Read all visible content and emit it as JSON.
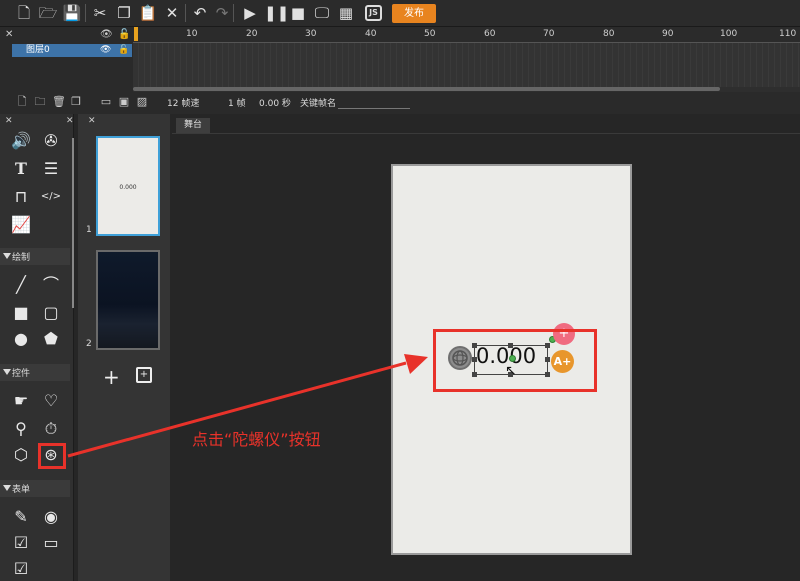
{
  "toolbar": {
    "icons": [
      "new-file-icon",
      "open-folder-icon",
      "save-icon",
      "cut-icon",
      "copy-icon",
      "paste-icon",
      "delete-icon",
      "undo-icon",
      "redo-icon",
      "play-icon",
      "pause-icon",
      "stop-icon",
      "preview-icon",
      "qrcode-icon",
      "js-icon"
    ],
    "js_label": "JS",
    "publish_label": "发布"
  },
  "timeline": {
    "ruler": [
      "10",
      "20",
      "30",
      "40",
      "50",
      "60",
      "70",
      "80",
      "90",
      "100",
      "110"
    ],
    "layer_name": "图层0",
    "fps": "12 帧速",
    "frame": "1 帧",
    "time": "0.00 秒",
    "keyframe_label": "关键帧名"
  },
  "tool_panel": {
    "sections": [
      "绘制",
      "控件",
      "表单"
    ]
  },
  "slides": [
    {
      "num": "1",
      "text": "0.000"
    },
    {
      "num": "2",
      "text": ""
    }
  ],
  "stage": {
    "tab_label": "舞台",
    "gyro_value": "0.000"
  },
  "annotation": {
    "text": "点击“陀螺仪”按钮",
    "color": "#e8322a"
  }
}
